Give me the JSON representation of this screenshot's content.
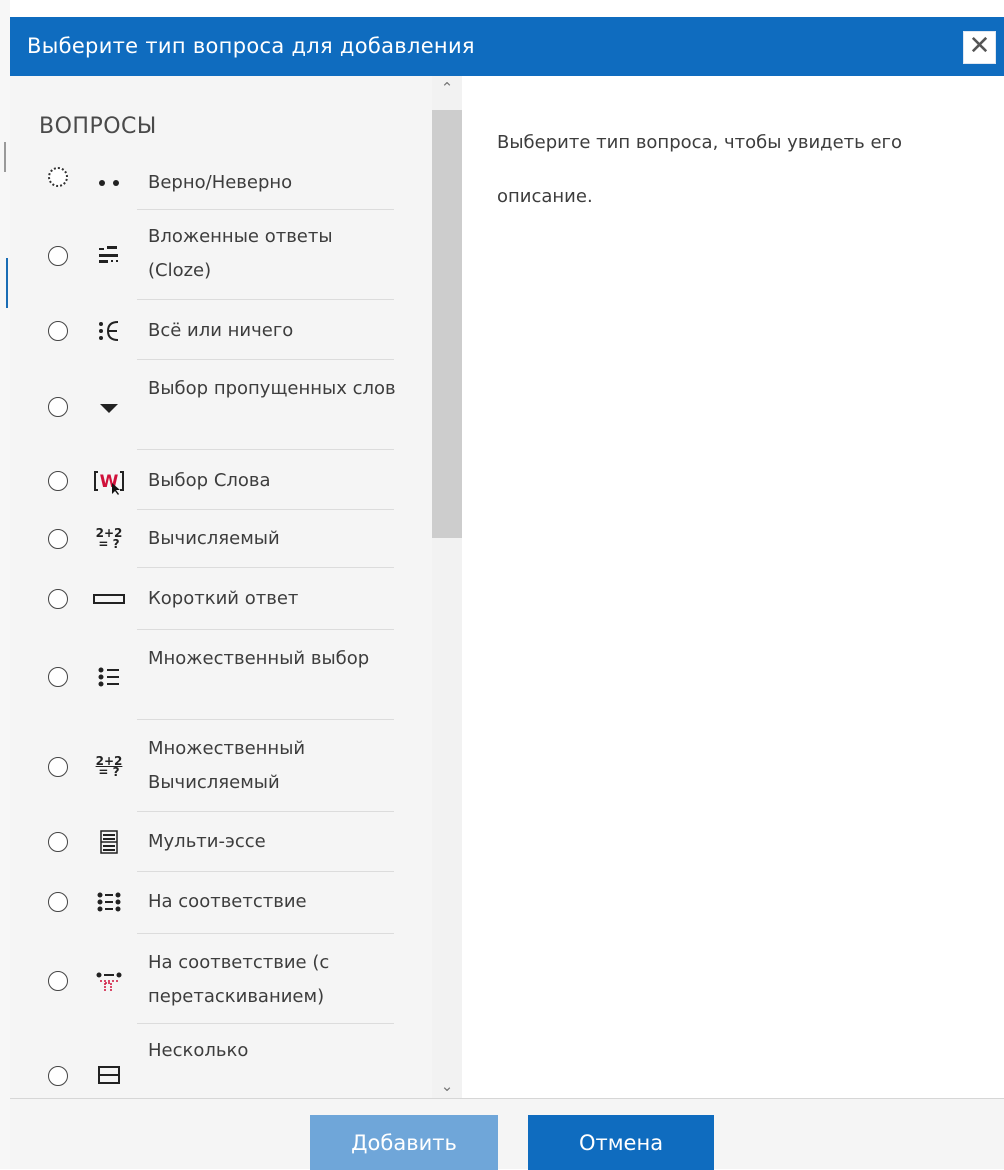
{
  "dialog": {
    "title": "Выберите тип вопроса для добавления",
    "close_glyph": "✕"
  },
  "left_panel": {
    "section_title": "ВОПРОСЫ",
    "items": [
      {
        "label": "Верно/Неверно",
        "icon": "true-false-icon",
        "selected": false
      },
      {
        "label": "Вложенные ответы (Cloze)",
        "icon": "cloze-icon",
        "selected": false
      },
      {
        "label": "Всё или ничего",
        "icon": "all-or-nothing-icon",
        "selected": false
      },
      {
        "label": "Выбор пропущенных слов",
        "icon": "dropdown-triangle-icon",
        "selected": false
      },
      {
        "label": "Выбор Слова",
        "icon": "word-select-icon",
        "selected": false
      },
      {
        "label": "Вычисляемый",
        "icon": "calculated-icon",
        "selected": false
      },
      {
        "label": "Короткий ответ",
        "icon": "short-answer-icon",
        "selected": false
      },
      {
        "label": "Множественный выбор",
        "icon": "multichoice-icon",
        "selected": false
      },
      {
        "label": "Множественный Вычисляемый",
        "icon": "calculated-multi-icon",
        "selected": false
      },
      {
        "label": "Мульти-эссе",
        "icon": "multi-essay-icon",
        "selected": false
      },
      {
        "label": "На соответствие",
        "icon": "matching-icon",
        "selected": false
      },
      {
        "label": "На соответствие (с перетаскиванием)",
        "icon": "drag-matching-icon",
        "selected": false
      },
      {
        "label": "Несколько",
        "icon": "multiple-icon",
        "selected": false
      }
    ]
  },
  "icons": {
    "word_select_letter": "W",
    "calc_top": "2+2",
    "calc_bottom": "= ?"
  },
  "right_panel": {
    "description": "Выберите тип вопроса, чтобы увидеть его описание."
  },
  "scrollbar": {
    "up_glyph": "⌃",
    "down_glyph": "⌄"
  },
  "footer": {
    "add_label": "Добавить",
    "cancel_label": "Отмена"
  },
  "colors": {
    "header": "#0f6cbf",
    "add_button": "#6fa6d9",
    "cancel_button": "#0f6cbf",
    "panel_bg": "#f5f5f5"
  }
}
